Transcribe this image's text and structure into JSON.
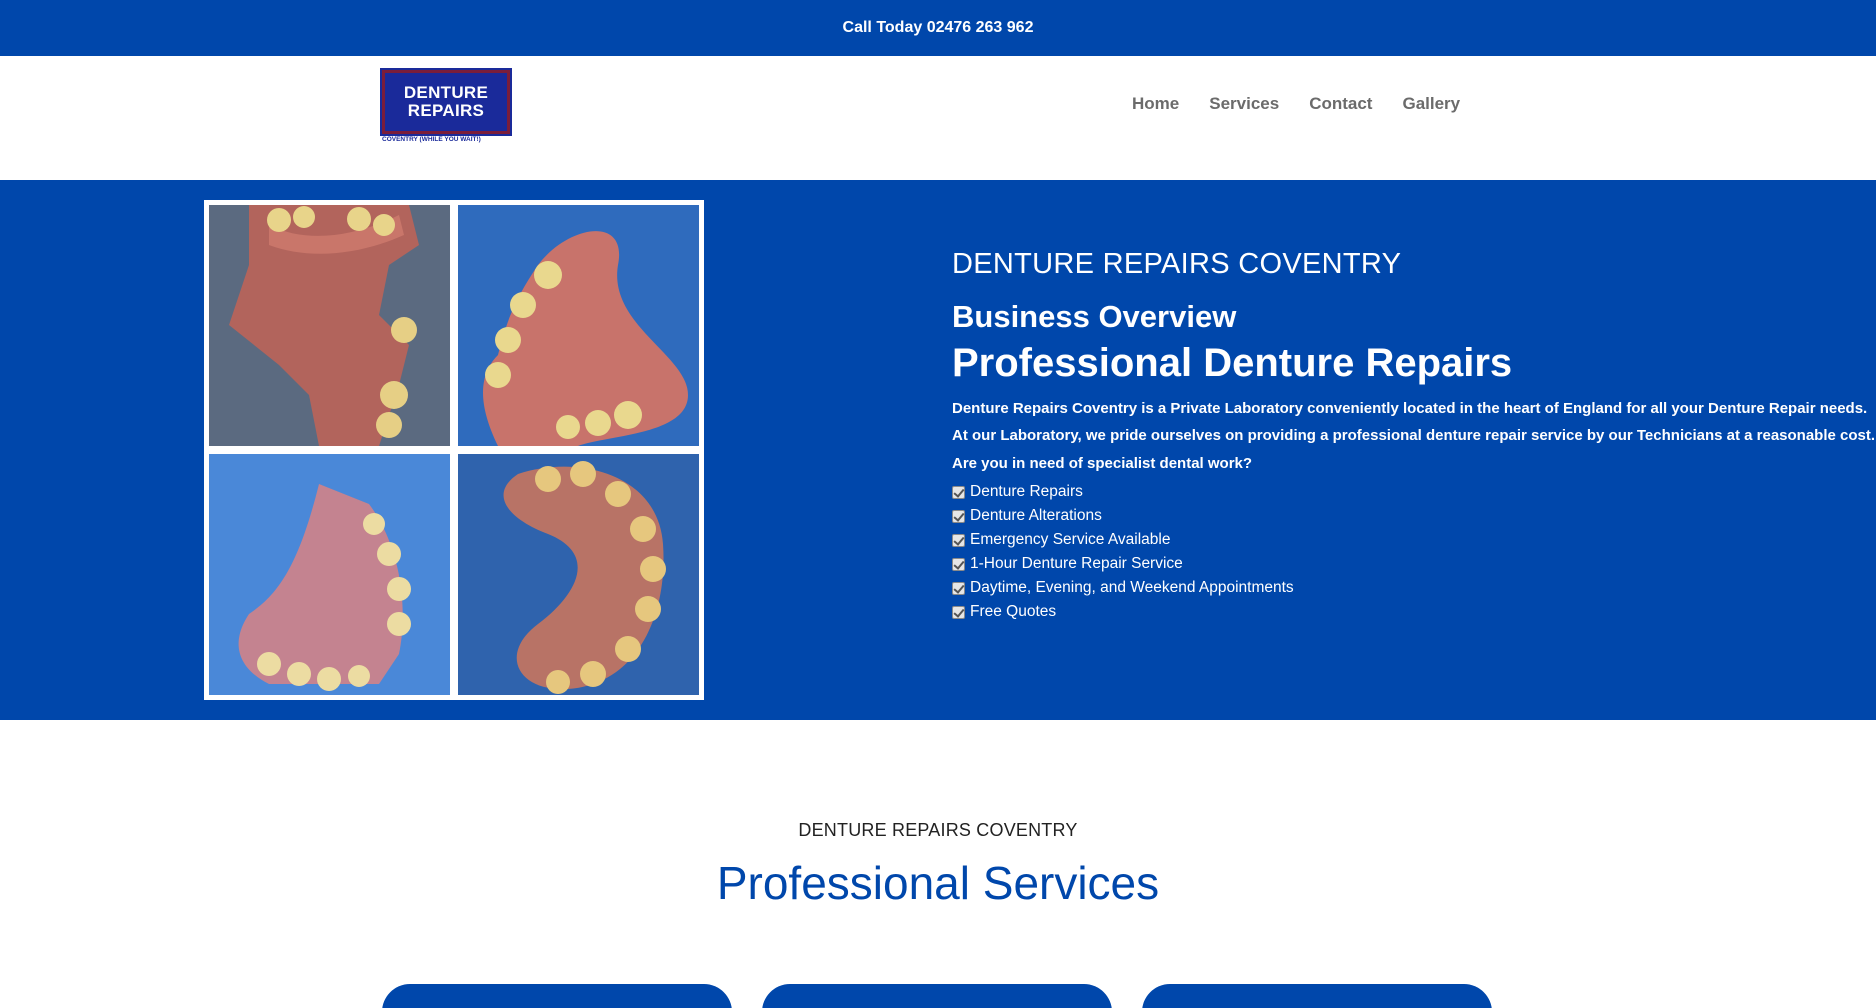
{
  "topbar": {
    "call_text": "Call Today 02476 263 962"
  },
  "logo": {
    "line1": "DENTURE",
    "line2": "REPAIRS",
    "tagline": "COVENTRY (WHILE YOU WAIT!)"
  },
  "nav": {
    "items": [
      "Home",
      "Services",
      "Contact",
      "Gallery"
    ]
  },
  "hero": {
    "kicker": "DENTURE REPAIRS COVENTRY",
    "subtitle": "Business Overview",
    "title": "Professional Denture Repairs",
    "paragraphs": [
      "Denture Repairs Coventry is a Private Laboratory conveniently located in the heart of England for all your Denture Repair needs.",
      "At our Laboratory, we pride ourselves on providing a professional denture repair service by our Technicians at a reasonable cost.",
      "Are you in need of specialist dental work?"
    ],
    "checklist": [
      "Denture Repairs",
      "Denture Alterations",
      "Emergency Service Available",
      "1-Hour Denture Repair Service",
      "Daytime, Evening, and Weekend Appointments",
      "Free Quotes"
    ]
  },
  "services": {
    "kicker": "DENTURE REPAIRS COVENTRY",
    "title": "Professional Services"
  },
  "colors": {
    "brand_blue": "#0047ab",
    "nav_gray": "#6b6b6b",
    "white": "#ffffff"
  }
}
